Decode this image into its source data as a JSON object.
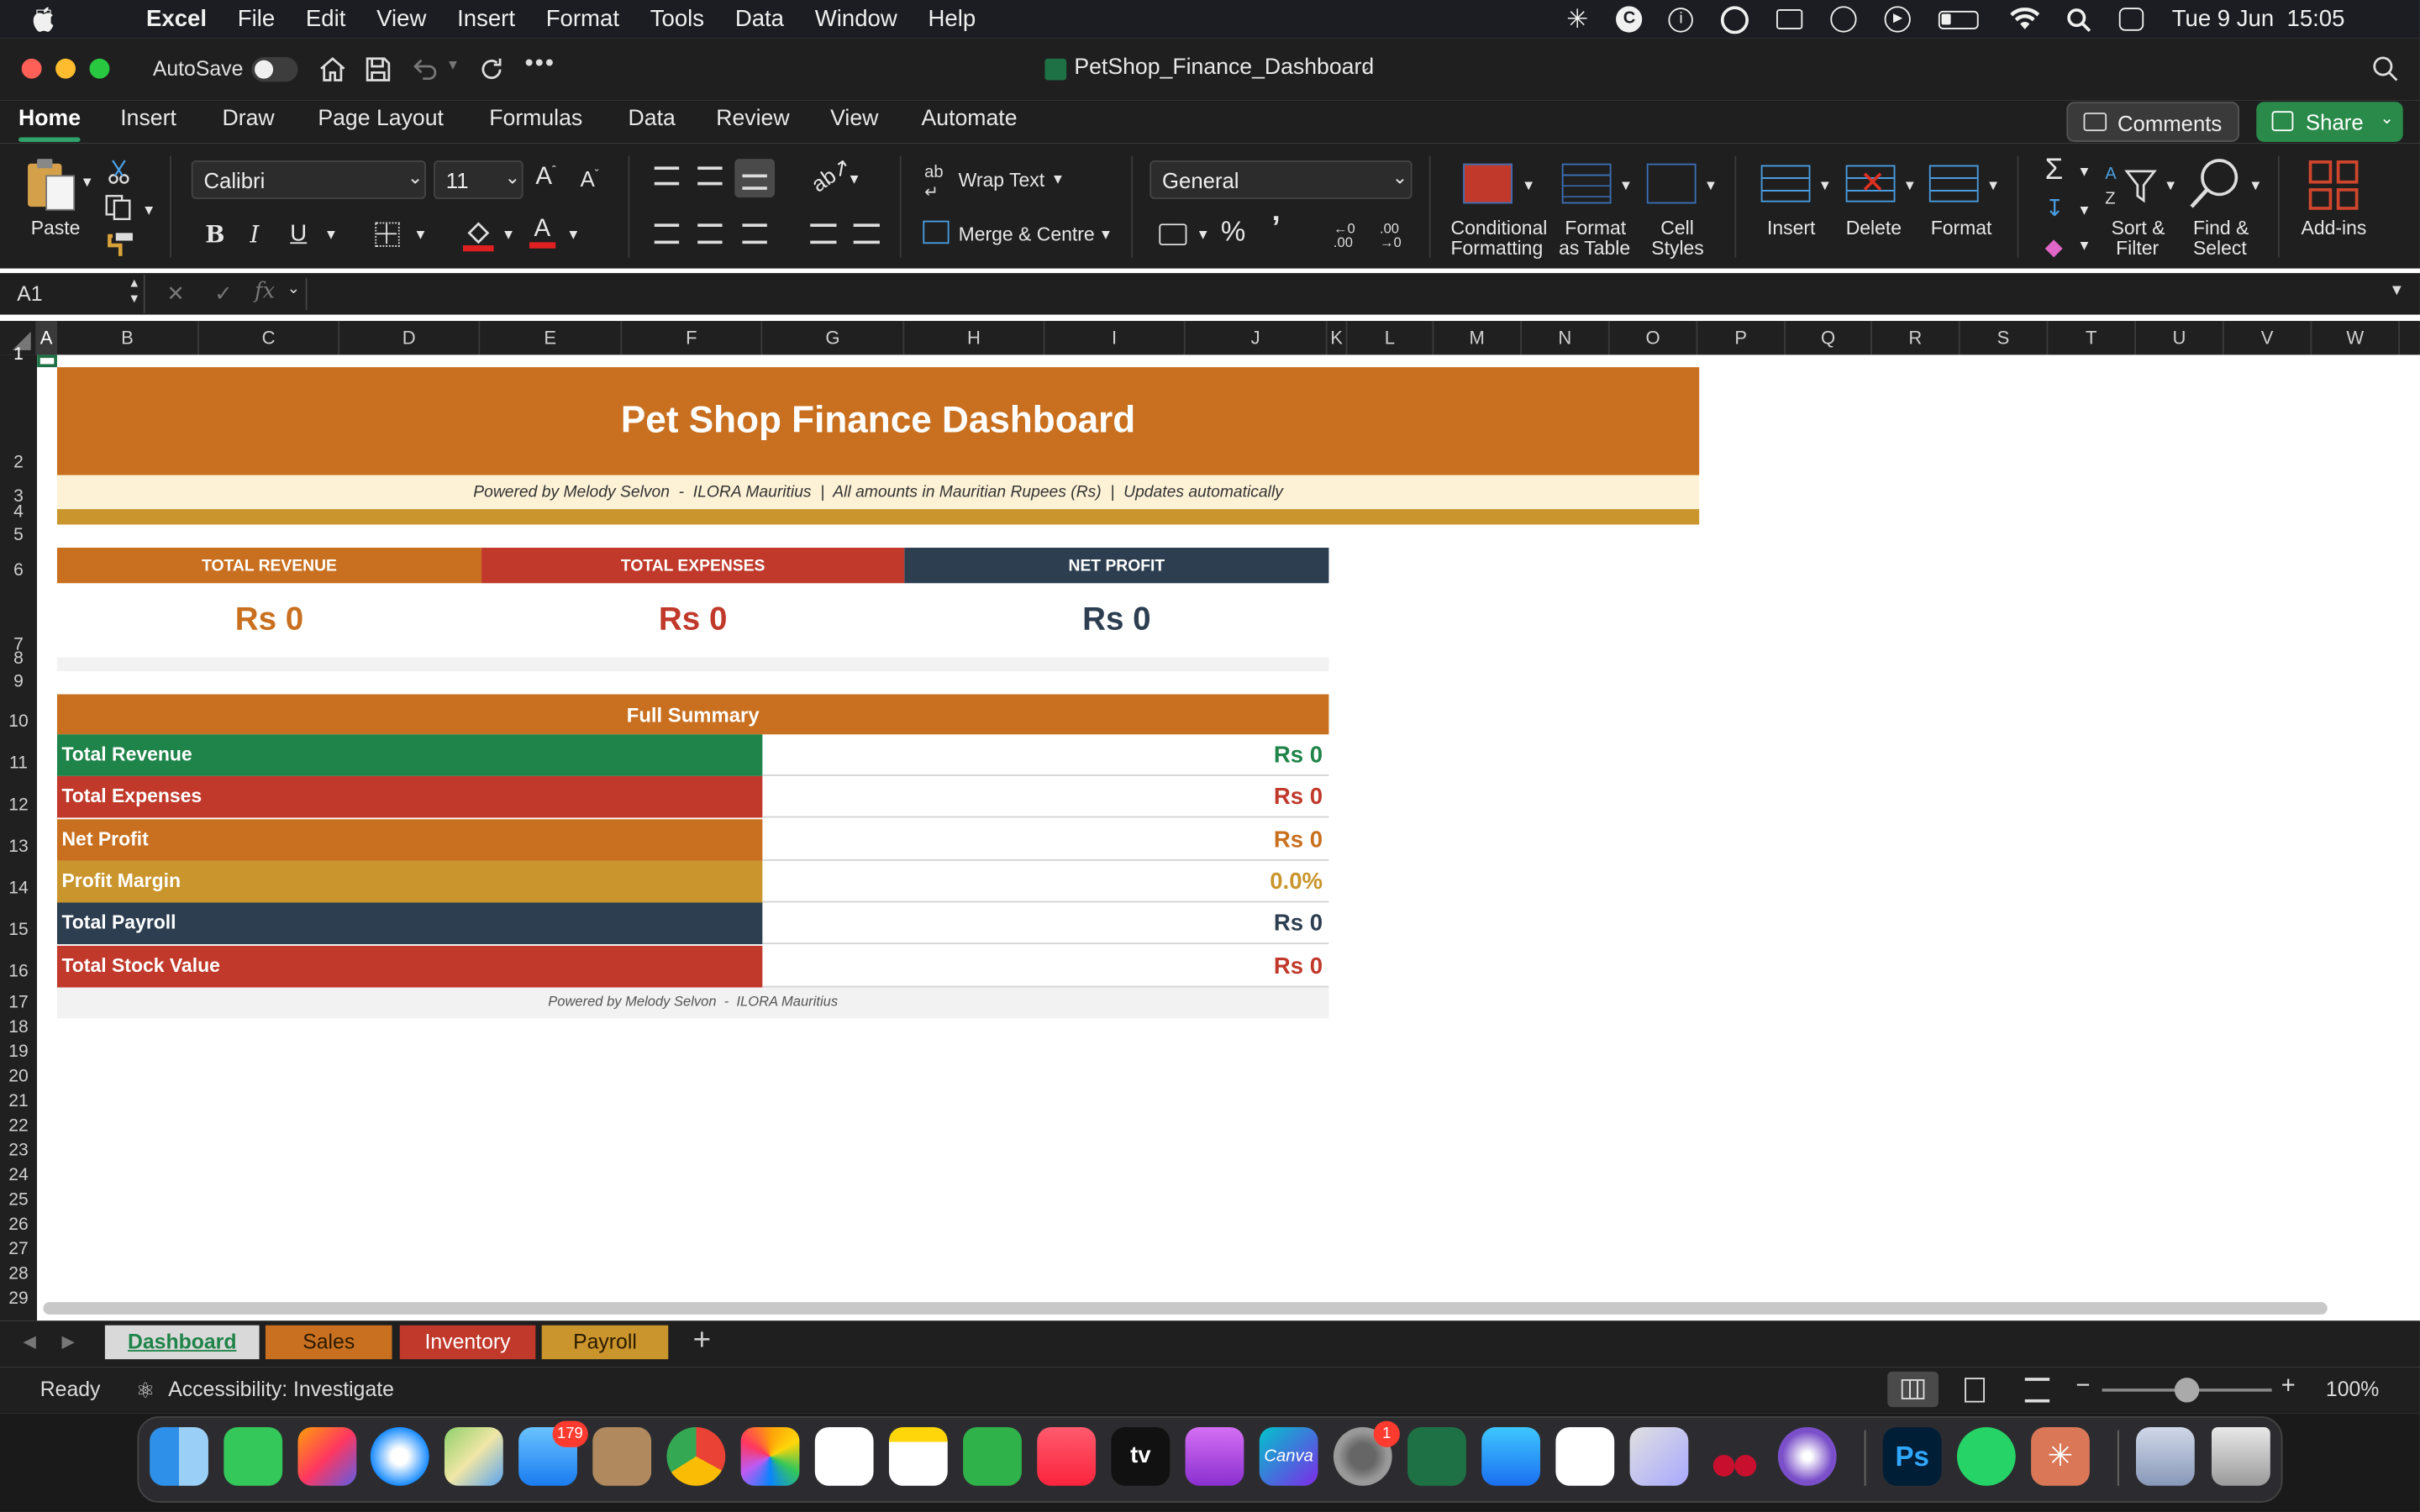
{
  "menubar": {
    "app_name": "Excel",
    "items": [
      "File",
      "Edit",
      "View",
      "Insert",
      "Format",
      "Tools",
      "Data",
      "Window",
      "Help"
    ],
    "clock": "Tue 9 Jun  15:05"
  },
  "titlebar": {
    "autosave_label": "AutoSave",
    "document_title": "PetShop_Finance_Dashboard"
  },
  "ribbon_tabs": [
    "Home",
    "Insert",
    "Draw",
    "Page Layout",
    "Formulas",
    "Data",
    "Review",
    "View",
    "Automate"
  ],
  "ribbon_active_tab": "Home",
  "ribbon_buttons": {
    "comments": "Comments",
    "share": "Share",
    "paste": "Paste",
    "font_name": "Calibri",
    "font_size": "11",
    "wrap_text": "Wrap Text",
    "merge_centre": "Merge & Centre",
    "number_format": "General",
    "conditional_formatting": [
      "Conditional",
      "Formatting"
    ],
    "format_as_table": [
      "Format",
      "as Table"
    ],
    "cell_styles": [
      "Cell",
      "Styles"
    ],
    "insert": "Insert",
    "delete": "Delete",
    "format": "Format",
    "sort_filter": [
      "Sort &",
      "Filter"
    ],
    "find_select": [
      "Find &",
      "Select"
    ],
    "add_ins": "Add-ins"
  },
  "formula_bar": {
    "name_box": "A1",
    "fx": "fx",
    "formula": ""
  },
  "columns": [
    "A",
    "B",
    "C",
    "D",
    "E",
    "F",
    "G",
    "H",
    "I",
    "J",
    "K",
    "L",
    "M",
    "N",
    "O",
    "P",
    "Q",
    "R",
    "S",
    "T",
    "U",
    "V",
    "W"
  ],
  "rows": [
    "1",
    "2",
    "3",
    "4",
    "5",
    "6",
    "7",
    "8",
    "9",
    "10",
    "11",
    "12",
    "13",
    "14",
    "15",
    "16",
    "17",
    "18",
    "19",
    "20",
    "21",
    "22",
    "23",
    "24",
    "25",
    "26",
    "27",
    "28",
    "29"
  ],
  "dashboard": {
    "title": "Pet Shop Finance Dashboard",
    "subtitle": "Powered by Melody Selvon  -  ILORA Mauritius  |  All amounts in Mauritian Rupees (Rs)  |  Updates automatically",
    "kpis": [
      {
        "label": "TOTAL REVENUE",
        "value": "Rs 0",
        "color": "#c97020"
      },
      {
        "label": "TOTAL EXPENSES",
        "value": "Rs 0",
        "color": "#c0392b"
      },
      {
        "label": "NET PROFIT",
        "value": "Rs 0",
        "color": "#2c3e50"
      }
    ],
    "summary_header": "Full Summary",
    "summary": [
      {
        "label": "Total Revenue",
        "value": "Rs 0",
        "bg": "#1e8449",
        "fg": "#1e8449"
      },
      {
        "label": "Total Expenses",
        "value": "Rs 0",
        "bg": "#c0392b",
        "fg": "#c0392b"
      },
      {
        "label": "Net Profit",
        "value": "Rs 0",
        "bg": "#c97020",
        "fg": "#c97020"
      },
      {
        "label": "Profit Margin",
        "value": "0.0%",
        "bg": "#c9952c",
        "fg": "#c9952c"
      },
      {
        "label": "Total Payroll",
        "value": "Rs 0",
        "bg": "#2c3e50",
        "fg": "#2c3e50"
      },
      {
        "label": "Total Stock Value",
        "value": "Rs 0",
        "bg": "#c0392b",
        "fg": "#c0392b"
      }
    ],
    "footer": "Powered by Melody Selvon  -  ILORA Mauritius"
  },
  "sheet_tabs": [
    {
      "name": "Dashboard",
      "bg": "#d9d9d9",
      "fg": "#1e8449"
    },
    {
      "name": "Sales",
      "bg": "#c97020",
      "fg": "#2a1a00"
    },
    {
      "name": "Inventory",
      "bg": "#c0392b",
      "fg": "#ffffff"
    },
    {
      "name": "Payroll",
      "bg": "#c9952c",
      "fg": "#2a1a00"
    }
  ],
  "add_sheet": "+",
  "status": {
    "ready": "Ready",
    "accessibility": "Accessibility: Investigate",
    "zoom": "100%"
  },
  "dock": {
    "mail_badge": "179",
    "settings_badge": "1",
    "canva_label": "Canva",
    "ps_label": "Ps",
    "tv_label": "tv"
  },
  "colors": {
    "orange": "#c97020",
    "red": "#c0392b",
    "navy": "#2c3e50",
    "green": "#1e8449",
    "gold": "#c9952c",
    "cream": "#fdf2d6"
  }
}
